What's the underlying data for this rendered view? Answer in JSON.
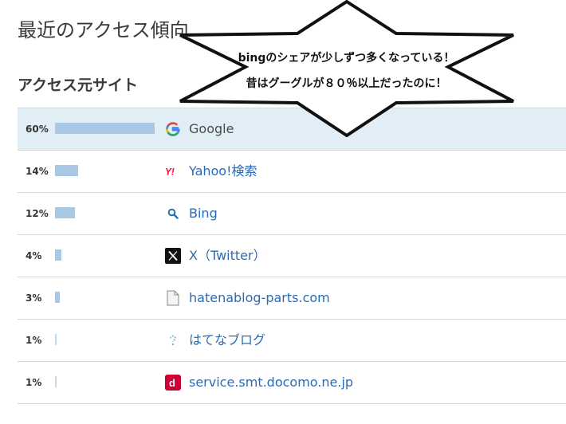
{
  "page": {
    "title": "最近のアクセス傾向",
    "section_heading": "アクセス元サイト"
  },
  "sources": [
    {
      "percent_label": "60%",
      "share": 0.6,
      "name": "Google",
      "icon": "google-icon",
      "highlight": true
    },
    {
      "percent_label": "14%",
      "share": 0.14,
      "name": "Yahoo!検索",
      "icon": "yahoo-icon",
      "highlight": false
    },
    {
      "percent_label": "12%",
      "share": 0.12,
      "name": "Bing",
      "icon": "bing-search-icon",
      "highlight": false
    },
    {
      "percent_label": "4%",
      "share": 0.04,
      "name": "X（Twitter）",
      "icon": "x-twitter-icon",
      "highlight": false
    },
    {
      "percent_label": "3%",
      "share": 0.03,
      "name": "hatenablog-parts.com",
      "icon": "document-icon",
      "highlight": false
    },
    {
      "percent_label": "1%",
      "share": 0.01,
      "name": "はてなブログ",
      "icon": "hatena-icon",
      "highlight": false
    },
    {
      "percent_label": "1%",
      "share": 0.01,
      "name": "service.smt.docomo.ne.jp",
      "icon": "docomo-icon",
      "highlight": false
    }
  ],
  "callout": {
    "line1": "bingのシェアが少しずつ多くなっている！",
    "line2": "昔はグーグルが８０％以上だったのに！"
  },
  "colors": {
    "bar": "#a9c8e6",
    "highlight_row": "#e1eef6",
    "link": "#2a6bb5"
  }
}
